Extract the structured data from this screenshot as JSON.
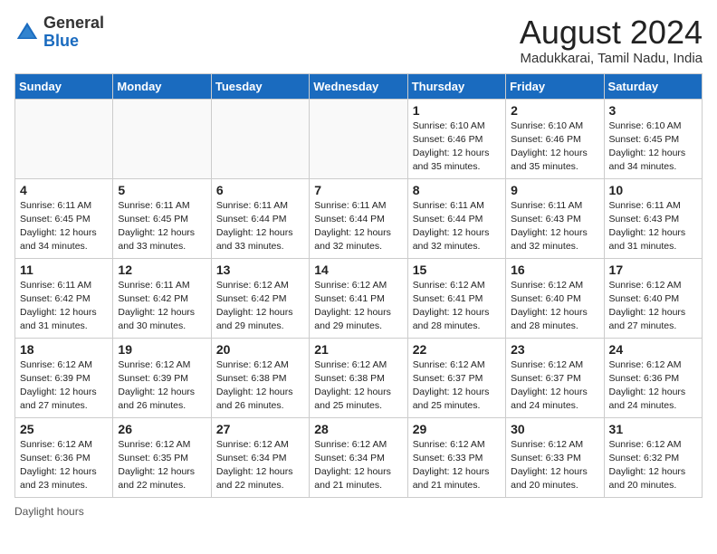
{
  "header": {
    "logo_general": "General",
    "logo_blue": "Blue",
    "month_year": "August 2024",
    "location": "Madukkarai, Tamil Nadu, India"
  },
  "days_of_week": [
    "Sunday",
    "Monday",
    "Tuesday",
    "Wednesday",
    "Thursday",
    "Friday",
    "Saturday"
  ],
  "footer": {
    "label": "Daylight hours"
  },
  "weeks": [
    [
      {
        "day": "",
        "info": ""
      },
      {
        "day": "",
        "info": ""
      },
      {
        "day": "",
        "info": ""
      },
      {
        "day": "",
        "info": ""
      },
      {
        "day": "1",
        "info": "Sunrise: 6:10 AM\nSunset: 6:46 PM\nDaylight: 12 hours\nand 35 minutes."
      },
      {
        "day": "2",
        "info": "Sunrise: 6:10 AM\nSunset: 6:46 PM\nDaylight: 12 hours\nand 35 minutes."
      },
      {
        "day": "3",
        "info": "Sunrise: 6:10 AM\nSunset: 6:45 PM\nDaylight: 12 hours\nand 34 minutes."
      }
    ],
    [
      {
        "day": "4",
        "info": "Sunrise: 6:11 AM\nSunset: 6:45 PM\nDaylight: 12 hours\nand 34 minutes."
      },
      {
        "day": "5",
        "info": "Sunrise: 6:11 AM\nSunset: 6:45 PM\nDaylight: 12 hours\nand 33 minutes."
      },
      {
        "day": "6",
        "info": "Sunrise: 6:11 AM\nSunset: 6:44 PM\nDaylight: 12 hours\nand 33 minutes."
      },
      {
        "day": "7",
        "info": "Sunrise: 6:11 AM\nSunset: 6:44 PM\nDaylight: 12 hours\nand 32 minutes."
      },
      {
        "day": "8",
        "info": "Sunrise: 6:11 AM\nSunset: 6:44 PM\nDaylight: 12 hours\nand 32 minutes."
      },
      {
        "day": "9",
        "info": "Sunrise: 6:11 AM\nSunset: 6:43 PM\nDaylight: 12 hours\nand 32 minutes."
      },
      {
        "day": "10",
        "info": "Sunrise: 6:11 AM\nSunset: 6:43 PM\nDaylight: 12 hours\nand 31 minutes."
      }
    ],
    [
      {
        "day": "11",
        "info": "Sunrise: 6:11 AM\nSunset: 6:42 PM\nDaylight: 12 hours\nand 31 minutes."
      },
      {
        "day": "12",
        "info": "Sunrise: 6:11 AM\nSunset: 6:42 PM\nDaylight: 12 hours\nand 30 minutes."
      },
      {
        "day": "13",
        "info": "Sunrise: 6:12 AM\nSunset: 6:42 PM\nDaylight: 12 hours\nand 29 minutes."
      },
      {
        "day": "14",
        "info": "Sunrise: 6:12 AM\nSunset: 6:41 PM\nDaylight: 12 hours\nand 29 minutes."
      },
      {
        "day": "15",
        "info": "Sunrise: 6:12 AM\nSunset: 6:41 PM\nDaylight: 12 hours\nand 28 minutes."
      },
      {
        "day": "16",
        "info": "Sunrise: 6:12 AM\nSunset: 6:40 PM\nDaylight: 12 hours\nand 28 minutes."
      },
      {
        "day": "17",
        "info": "Sunrise: 6:12 AM\nSunset: 6:40 PM\nDaylight: 12 hours\nand 27 minutes."
      }
    ],
    [
      {
        "day": "18",
        "info": "Sunrise: 6:12 AM\nSunset: 6:39 PM\nDaylight: 12 hours\nand 27 minutes."
      },
      {
        "day": "19",
        "info": "Sunrise: 6:12 AM\nSunset: 6:39 PM\nDaylight: 12 hours\nand 26 minutes."
      },
      {
        "day": "20",
        "info": "Sunrise: 6:12 AM\nSunset: 6:38 PM\nDaylight: 12 hours\nand 26 minutes."
      },
      {
        "day": "21",
        "info": "Sunrise: 6:12 AM\nSunset: 6:38 PM\nDaylight: 12 hours\nand 25 minutes."
      },
      {
        "day": "22",
        "info": "Sunrise: 6:12 AM\nSunset: 6:37 PM\nDaylight: 12 hours\nand 25 minutes."
      },
      {
        "day": "23",
        "info": "Sunrise: 6:12 AM\nSunset: 6:37 PM\nDaylight: 12 hours\nand 24 minutes."
      },
      {
        "day": "24",
        "info": "Sunrise: 6:12 AM\nSunset: 6:36 PM\nDaylight: 12 hours\nand 24 minutes."
      }
    ],
    [
      {
        "day": "25",
        "info": "Sunrise: 6:12 AM\nSunset: 6:36 PM\nDaylight: 12 hours\nand 23 minutes."
      },
      {
        "day": "26",
        "info": "Sunrise: 6:12 AM\nSunset: 6:35 PM\nDaylight: 12 hours\nand 22 minutes."
      },
      {
        "day": "27",
        "info": "Sunrise: 6:12 AM\nSunset: 6:34 PM\nDaylight: 12 hours\nand 22 minutes."
      },
      {
        "day": "28",
        "info": "Sunrise: 6:12 AM\nSunset: 6:34 PM\nDaylight: 12 hours\nand 21 minutes."
      },
      {
        "day": "29",
        "info": "Sunrise: 6:12 AM\nSunset: 6:33 PM\nDaylight: 12 hours\nand 21 minutes."
      },
      {
        "day": "30",
        "info": "Sunrise: 6:12 AM\nSunset: 6:33 PM\nDaylight: 12 hours\nand 20 minutes."
      },
      {
        "day": "31",
        "info": "Sunrise: 6:12 AM\nSunset: 6:32 PM\nDaylight: 12 hours\nand 20 minutes."
      }
    ]
  ]
}
